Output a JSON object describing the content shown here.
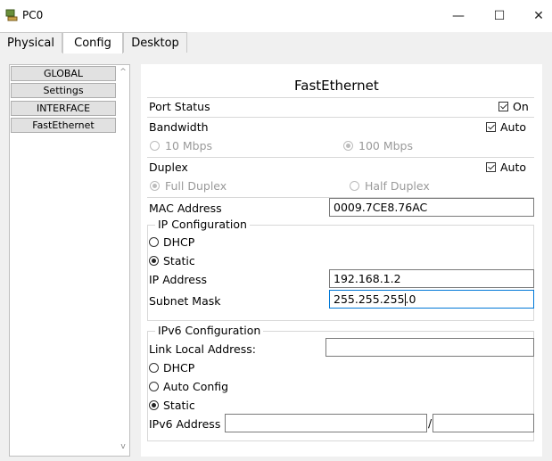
{
  "window": {
    "title": "PC0",
    "minimize": "—",
    "maximize": "☐",
    "close": "✕"
  },
  "tabs": [
    "Physical",
    "Config",
    "Desktop"
  ],
  "sidebar": {
    "items": [
      "GLOBAL",
      "Settings",
      "INTERFACE",
      "FastEthernet"
    ],
    "scroll_up": "^",
    "scroll_down": "v"
  },
  "panel": {
    "title": "FastEthernet",
    "port_status_label": "Port Status",
    "port_status_on": "On",
    "bandwidth_label": "Bandwidth",
    "bandwidth_auto": "Auto",
    "bw_10": "10 Mbps",
    "bw_100": "100 Mbps",
    "duplex_label": "Duplex",
    "duplex_auto": "Auto",
    "full_duplex": "Full Duplex",
    "half_duplex": "Half Duplex",
    "mac_label": "MAC Address",
    "mac_value": "0009.7CE8.76AC",
    "ip_config_legend": "IP Configuration",
    "dhcp": "DHCP",
    "static": "Static",
    "ip_label": "IP Address",
    "ip_value": "192.168.1.2",
    "mask_label": "Subnet Mask",
    "mask_value_a": "255.255.255",
    "mask_value_b": ".0",
    "ipv6_legend": "IPv6 Configuration",
    "link_local_label": "Link Local Address:",
    "link_local_value": "",
    "dhcp6": "DHCP",
    "auto_config": "Auto Config",
    "static6": "Static",
    "ipv6_label": "IPv6 Address",
    "ipv6_value": "",
    "ipv6_slash": "/",
    "ipv6_prefix": ""
  }
}
